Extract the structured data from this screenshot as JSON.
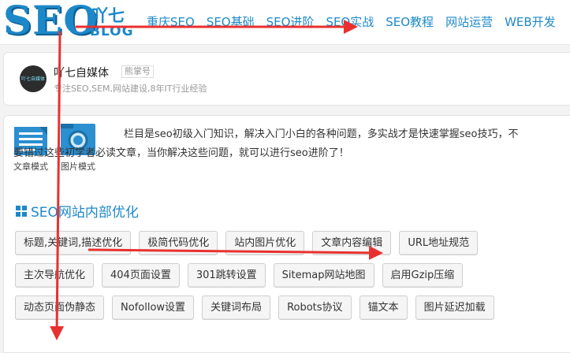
{
  "logo": {
    "seo": "SEO",
    "cn": "吖七",
    "blog": "BLOG"
  },
  "nav": [
    "重庆SEO",
    "SEO基础",
    "SEO进阶",
    "SEO实战",
    "SEO教程",
    "网站运营",
    "WEB开发"
  ],
  "profile": {
    "avatar_text": "吖七自媒体",
    "name": "吖七自媒体",
    "tag": "熊掌号",
    "desc": "专注SEO,SEM,网站建设,8年IT行业经验"
  },
  "modes": {
    "article": "文章模式",
    "image": "图片模式"
  },
  "intro": {
    "line1": "栏目是seo初级入门知识，解决入门小白的各种问题，多实战才是快速掌握seo技巧，不",
    "line2": "要错过这些初学者必读文章，当你解决这些问题，就可以进行seo进阶了！"
  },
  "section": {
    "icon": "grid-icon",
    "title": "SEO网站内部优化"
  },
  "tag_rows": [
    [
      "标题,关键词,描述优化",
      "极简代码优化",
      "站内图片优化",
      "文章内容编辑",
      "URL地址规范"
    ],
    [
      "主次导航优化",
      "404页面设置",
      "301跳转设置",
      "Sitemap网站地图",
      "启用Gzip压缩"
    ],
    [
      "动态页面伪静态",
      "Nofollow设置",
      "关键词布局",
      "Robots协议",
      "锚文本",
      "图片延迟加载"
    ]
  ],
  "colors": {
    "accent": "#1d88c9",
    "annotation": "#e8312f"
  }
}
